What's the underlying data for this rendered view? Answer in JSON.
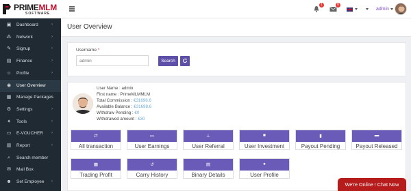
{
  "brand": {
    "name_prime": "PRIME",
    "name_mlm": "MLM",
    "subtitle": "SOFTWARE"
  },
  "topbar": {
    "notifications_badge": "1",
    "messages_badge": "0",
    "language_flag": "uk-flag-icon",
    "user_name": "admin"
  },
  "sidebar": {
    "items": [
      {
        "label": "Dashboard",
        "icon": "dashboard-icon",
        "glyph": "▣",
        "has_arrow": true
      },
      {
        "label": "Network",
        "icon": "network-icon",
        "glyph": "⁂",
        "has_arrow": true
      },
      {
        "label": "Signup",
        "icon": "signup-icon",
        "glyph": "✎",
        "has_arrow": true
      },
      {
        "label": "Finance",
        "icon": "finance-icon",
        "glyph": "▤",
        "has_arrow": true
      },
      {
        "label": "Profile",
        "icon": "profile-icon",
        "glyph": "☺",
        "has_arrow": true
      },
      {
        "label": "User Overview",
        "icon": "user-overview-icon",
        "glyph": "◉",
        "has_arrow": false,
        "active": true
      },
      {
        "label": "Manage Packages",
        "icon": "packages-icon",
        "glyph": "▦",
        "has_arrow": true
      },
      {
        "label": "Settings",
        "icon": "settings-icon",
        "glyph": "⚙",
        "has_arrow": true
      },
      {
        "label": "Tools",
        "icon": "tools-icon",
        "glyph": "✦",
        "has_arrow": true
      },
      {
        "label": "E-VOUCHER",
        "icon": "voucher-icon",
        "glyph": "▭",
        "has_arrow": true
      },
      {
        "label": "Report",
        "icon": "report-icon",
        "glyph": "▥",
        "has_arrow": true
      },
      {
        "label": "Search member",
        "icon": "search-member-icon",
        "glyph": "⌕",
        "has_arrow": false
      },
      {
        "label": "Mail Box",
        "icon": "mailbox-icon",
        "glyph": "✉",
        "has_arrow": false
      },
      {
        "label": "Set Employee",
        "icon": "employee-icon",
        "glyph": "☻",
        "has_arrow": true
      }
    ],
    "arrow_glyph": "›"
  },
  "page": {
    "title": "User Overview"
  },
  "search": {
    "label": "Username",
    "required_mark": "*",
    "value": "admin",
    "search_button": "Search",
    "reset_icon": "refresh-icon"
  },
  "profile": {
    "rows": [
      {
        "label": "User Name :",
        "value": "admin",
        "link": false
      },
      {
        "label": "First name :",
        "value": "PrimeMLMMLM",
        "link": false
      },
      {
        "label": "Total Commission :",
        "value": "€31698.6",
        "link": true
      },
      {
        "label": "Available Balance :",
        "value": "€31698.6",
        "link": true
      },
      {
        "label": "Withdraw Pending :",
        "value": "€0",
        "link": true
      },
      {
        "label": "Withdrawed amount :",
        "value": "€30",
        "link": true
      }
    ]
  },
  "cards": [
    {
      "label": "All transaction",
      "icon": "exchange-icon",
      "glyph": "⇄"
    },
    {
      "label": "User Earnings",
      "icon": "money-icon",
      "glyph": "▭"
    },
    {
      "label": "User Referral",
      "icon": "sitemap-icon",
      "glyph": "⊥"
    },
    {
      "label": "User Investment",
      "icon": "investment-icon",
      "glyph": "■"
    },
    {
      "label": "Payout Pending",
      "icon": "file-icon",
      "glyph": "▮"
    },
    {
      "label": "Payout Released",
      "icon": "folder-icon",
      "glyph": "▬"
    },
    {
      "label": "Trading Profit",
      "icon": "chart-icon",
      "glyph": "▦"
    },
    {
      "label": "Carry History",
      "icon": "history-icon",
      "glyph": "↺"
    },
    {
      "label": "Binary Details",
      "icon": "list-icon",
      "glyph": "▤"
    },
    {
      "label": "User Profile",
      "icon": "user-icon",
      "glyph": "●"
    }
  ],
  "chat": {
    "label": "We're Online ! Chat Now"
  },
  "colors": {
    "accent": "#5e50a8",
    "sidebar": "#1f2a33",
    "chat": "#b71c1c",
    "badge": "#e53935"
  }
}
